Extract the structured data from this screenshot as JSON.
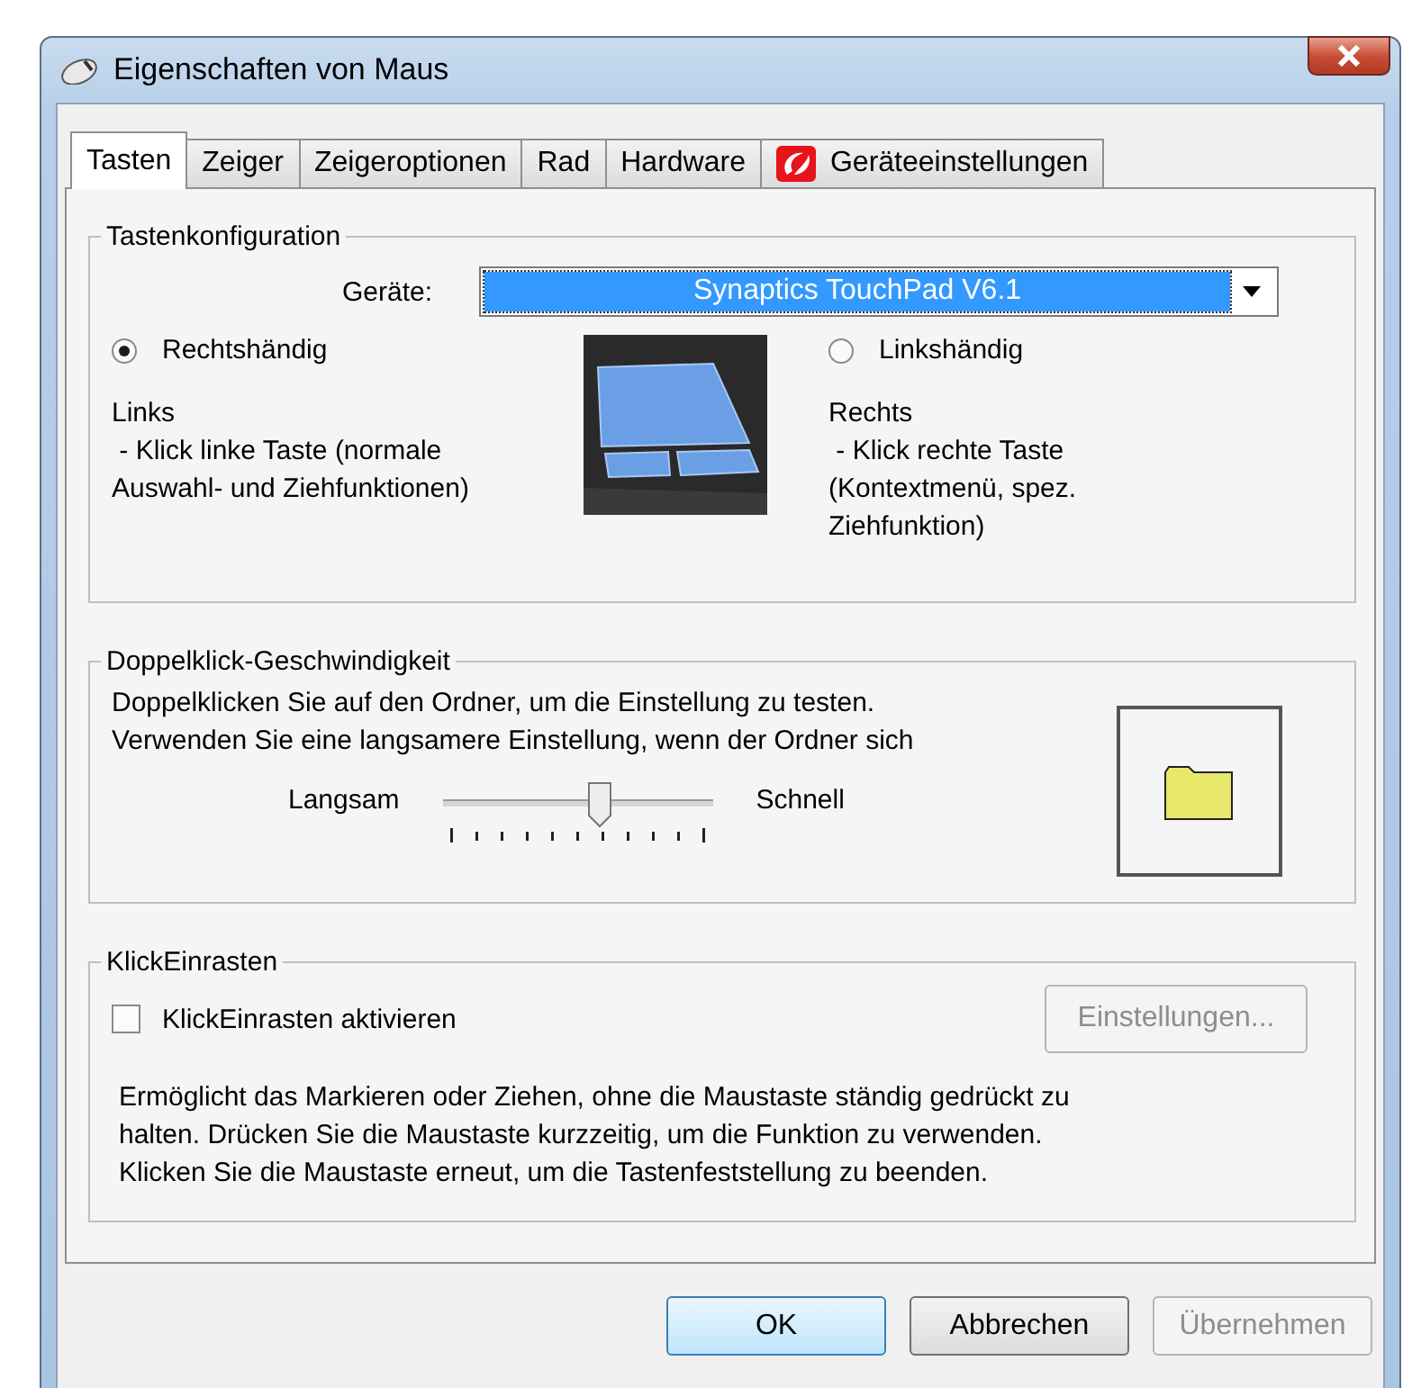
{
  "window": {
    "title": "Eigenschaften von Maus"
  },
  "tabs": [
    {
      "label": "Tasten",
      "selected": true,
      "kind": "plain"
    },
    {
      "label": "Zeiger",
      "selected": false,
      "kind": "plain"
    },
    {
      "label": "Zeigeroptionen",
      "selected": false,
      "kind": "plain"
    },
    {
      "label": "Rad",
      "selected": false,
      "kind": "plain"
    },
    {
      "label": "Hardware",
      "selected": false,
      "kind": "plain"
    },
    {
      "label": "Geräteeinstellungen",
      "selected": false,
      "kind": "icon"
    }
  ],
  "button_config": {
    "legend": "Tastenkonfiguration",
    "device_label": "Geräte:",
    "device_value": "Synaptics TouchPad V6.1",
    "options": [
      {
        "label": "Rechtshändig",
        "selected": true,
        "description": "Links\n - Klick linke Taste (normale\nAuswahl- und Ziehfunktionen)"
      },
      {
        "label": "Linkshändig",
        "selected": false,
        "description": "Rechts\n - Klick rechte Taste\n(Kontextmenü, spez.\nZiehfunktion)"
      }
    ]
  },
  "double_click": {
    "legend": "Doppelklick-Geschwindigkeit",
    "text": "Doppelklicken Sie auf den Ordner, um die Einstellung zu testen.\nVerwenden Sie eine langsamere Einstellung, wenn der Ordner sich",
    "slow_label": "Langsam",
    "fast_label": "Schnell",
    "speed": {
      "level": 0.58
    }
  },
  "click_lock": {
    "legend": "KlickEinrasten",
    "checkbox": {
      "label": "KlickEinrasten aktivieren",
      "checked": false
    },
    "settings_button": {
      "label": "Einstellungen...",
      "disabled": true
    },
    "description": "Ermöglicht das Markieren oder Ziehen, ohne die Maustaste ständig gedrückt zu\nhalten. Drücken Sie die Maustaste kurzzeitig, um die Funktion zu verwenden.\nKlicken Sie die Maustaste erneut, um die Tastenfeststellung zu beenden."
  },
  "buttons": [
    {
      "label": "OK",
      "kind": "default",
      "disabled": false
    },
    {
      "label": "Abbrechen",
      "kind": "normal",
      "disabled": false
    },
    {
      "label": "Übernehmen",
      "kind": "normal",
      "disabled": true
    }
  ]
}
